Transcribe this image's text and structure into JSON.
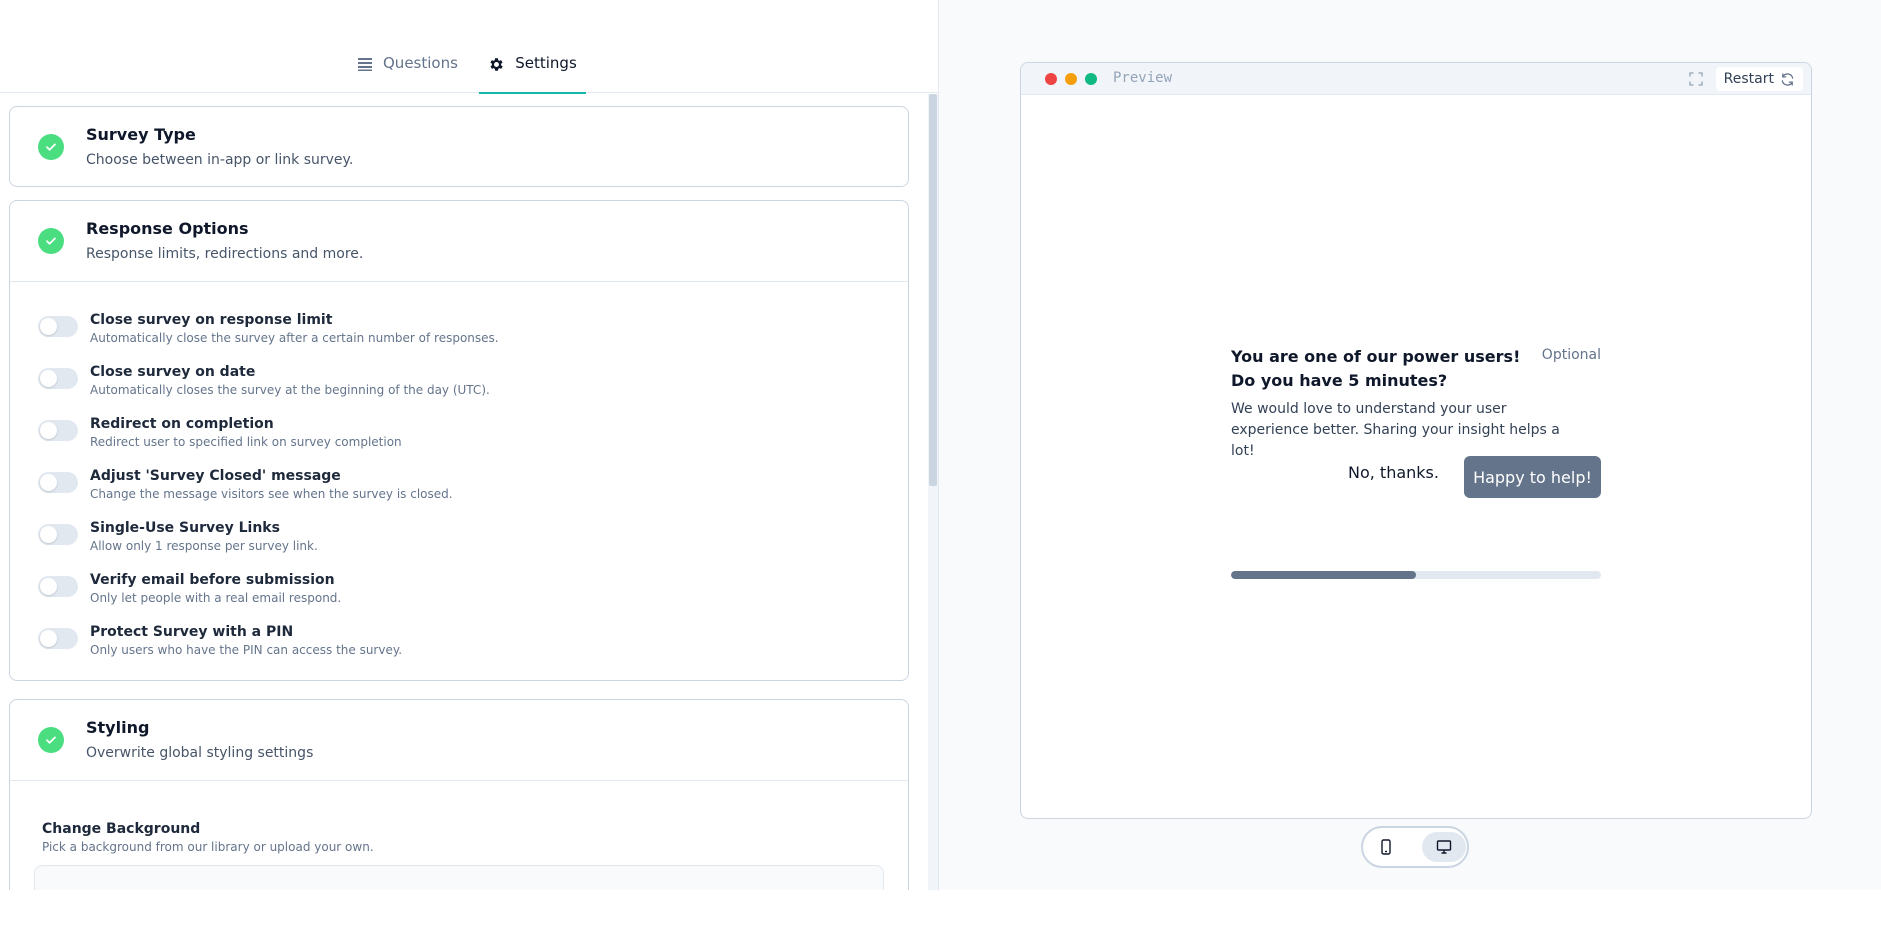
{
  "tabs": {
    "questions_label": "Questions",
    "settings_label": "Settings",
    "active": "settings"
  },
  "cards": {
    "survey_type": {
      "title": "Survey Type",
      "subtitle": "Choose between in-app or link survey."
    },
    "response_options": {
      "title": "Response Options",
      "subtitle": "Response limits, redirections and more.",
      "options": [
        {
          "title": "Close survey on response limit",
          "desc": "Automatically close the survey after a certain number of responses."
        },
        {
          "title": "Close survey on date",
          "desc": "Automatically closes the survey at the beginning of the day (UTC)."
        },
        {
          "title": "Redirect on completion",
          "desc": "Redirect user to specified link on survey completion"
        },
        {
          "title": "Adjust 'Survey Closed' message",
          "desc": "Change the message visitors see when the survey is closed."
        },
        {
          "title": "Single-Use Survey Links",
          "desc": "Allow only 1 response per survey link."
        },
        {
          "title": "Verify email before submission",
          "desc": "Only let people with a real email respond."
        },
        {
          "title": "Protect Survey with a PIN",
          "desc": "Only users who have the PIN can access the survey."
        }
      ]
    },
    "styling": {
      "title": "Styling",
      "subtitle": "Overwrite global styling settings",
      "background_title": "Change Background",
      "background_desc": "Pick a background from our library or upload your own."
    }
  },
  "preview": {
    "label": "Preview",
    "restart_label": "Restart",
    "question_headline": "You are one of our power users! Do you have 5 minutes?",
    "optional_label": "Optional",
    "question_subheader": "We would love to understand your user experience better. Sharing your insight helps a lot!",
    "dismiss_label": "No, thanks.",
    "accept_label": "Happy to help!",
    "progress": 0.5,
    "device_active": "desktop"
  },
  "colors": {
    "accent": "#14b8a6",
    "check_green": "#4ade80",
    "brand_button": "#64748b",
    "dot_red": "#ef4444",
    "dot_yellow": "#f59e0b",
    "dot_green": "#10b981"
  },
  "icons": {
    "questions_tab": "list-icon",
    "settings_tab": "gear-icon",
    "completed": "check-icon",
    "expand": "expand-icon",
    "restart": "refresh-icon",
    "mobile": "smartphone-icon",
    "desktop": "monitor-icon"
  }
}
